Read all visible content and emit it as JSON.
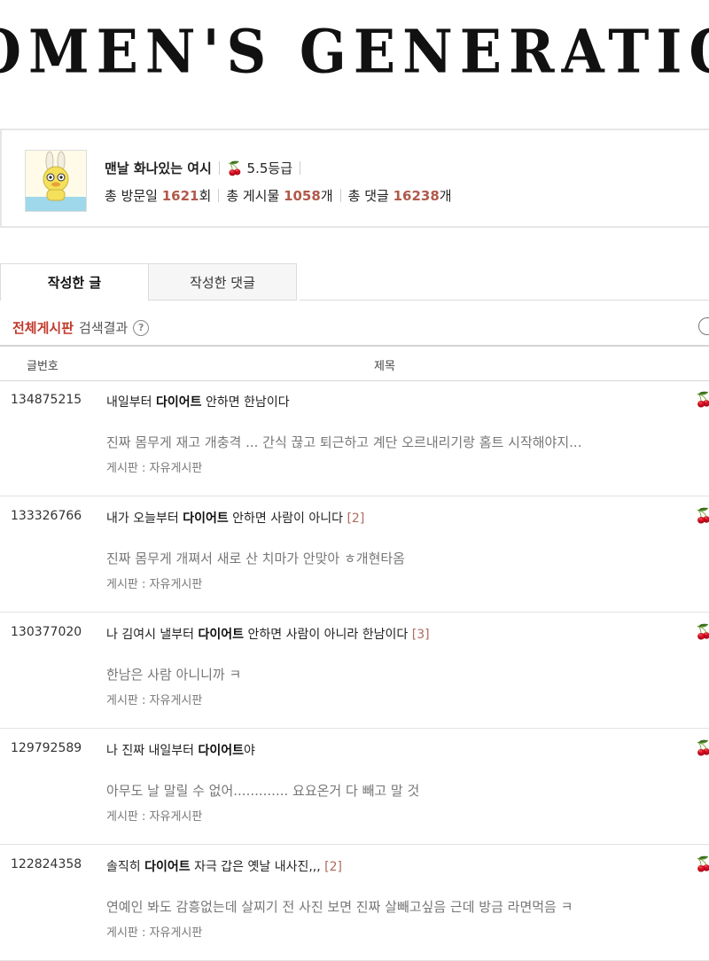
{
  "banner": {
    "text": "OMEN'S GENERATION"
  },
  "profile": {
    "nickname": "맨날 화나있는 여시",
    "grade": "5.5등급",
    "visit_label": "총 방문일",
    "visit_count": "1621",
    "visit_unit": "회",
    "posts_label": "총 게시물",
    "posts_count": "1058",
    "posts_unit": "개",
    "comments_label": "총 댓글",
    "comments_count": "16238",
    "comments_unit": "개"
  },
  "tabs": [
    {
      "label": "작성한 글",
      "active": true
    },
    {
      "label": "작성한 댓글",
      "active": false
    }
  ],
  "filter": {
    "board": "전체게시판",
    "label": "검색결과",
    "help": "?"
  },
  "table": {
    "col_no": "글번호",
    "col_title": "제목"
  },
  "posts": [
    {
      "no": "134875215",
      "title_pre": "내일부터 ",
      "keyword": "다이어트",
      "title_post": " 안하면 한남이다",
      "comments": "",
      "snippet": "진짜 몸무게 재고 개충격 ... 간식 끊고 퇴근하고 계단 오르내리기랑 홈트 시작해야지...",
      "board": "게시판 : 자유게시판"
    },
    {
      "no": "133326766",
      "title_pre": "내가 오늘부터 ",
      "keyword": "다이어트",
      "title_post": " 안하면 사람이 아니다 ",
      "comments": "[2]",
      "snippet": "진짜 몸무게 개쪄서 새로 산 치마가 안맞아 ㅎ개현타옴",
      "board": "게시판 : 자유게시판"
    },
    {
      "no": "130377020",
      "title_pre": "나 김여시 낼부터 ",
      "keyword": "다이어트",
      "title_post": " 안하면 사람이 아니라 한남이다 ",
      "comments": "[3]",
      "snippet": "한남은 사람 아니니까 ㅋ",
      "board": "게시판 : 자유게시판"
    },
    {
      "no": "129792589",
      "title_pre": "나 진짜 내일부터 ",
      "keyword": "다이어트",
      "title_post": "야",
      "comments": "",
      "snippet": "아무도 날 말릴 수 없어............. 요요온거 다 빼고 말 것",
      "board": "게시판 : 자유게시판"
    },
    {
      "no": "122824358",
      "title_pre": "솔직히 ",
      "keyword": "다이어트",
      "title_post": " 자극 갑은 옛날 내사진,,, ",
      "comments": "[2]",
      "snippet": "연예인 봐도 감흥없는데 살찌기 전 사진 보면 진짜 살빼고싶음 근데 방금 라면먹음 ㅋ",
      "board": "게시판 : 자유게시판"
    }
  ],
  "icons": {
    "grade": "cherry-icon",
    "help": "question-circle-icon",
    "avatar": "bunny-character"
  },
  "colors": {
    "accent_red": "#c0392b",
    "count_brown": "#b15a4a"
  }
}
